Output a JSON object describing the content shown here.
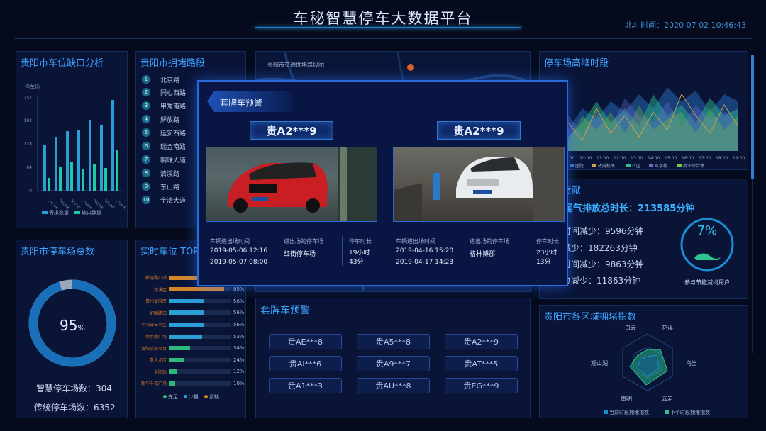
{
  "header": {
    "title": "车秘智慧停车大数据平台",
    "time_label": "北斗时间：",
    "time_value": "2020 07 02 10:46:43"
  },
  "gap_panel": {
    "title": "贵阳市车位缺口分析",
    "y_unit": "停车场",
    "y_ticks": [
      "257",
      "192",
      "128",
      "64",
      "0"
    ],
    "x_labels": [
      "2013年",
      "2014年",
      "2015年",
      "2016年",
      "2017年",
      "2018年",
      "2019年"
    ],
    "legend": [
      "需求数量",
      "缺口数量"
    ],
    "colors": [
      "#2a9fd6",
      "#1ec9a8"
    ]
  },
  "congest_panel": {
    "title": "贵阳市拥堵路段",
    "roads": [
      "北京路",
      "同心西路",
      "甲秀南路",
      "解放路",
      "延安西路",
      "瑞金南路",
      "明珠大道",
      "清溪路",
      "东山路",
      "金清大道"
    ]
  },
  "map_panel": {
    "title": "贵阳市交通拥堵路段图"
  },
  "peak_panel": {
    "title": "停车场高峰时段",
    "x_labels": [
      "09:00",
      "10:00",
      "11:00",
      "12:00",
      "13:00",
      "14:00",
      "15:00",
      "16:00",
      "17:00",
      "18:00",
      "19:00"
    ],
    "legend": [
      "医院",
      "政府机关",
      "社区",
      "写字楼",
      "商业综合体"
    ],
    "colors": [
      "#2a78c8",
      "#c9a24a",
      "#2ec28e",
      "#6a6ad8",
      "#7ac84a"
    ]
  },
  "env_panel": {
    "title": "环保贡献",
    "headline": "减少尾气排放总时长：213585分钟",
    "lines": [
      "寻车时间减少：9596分钟",
      "诱导减少：182263分钟",
      "排队时间减少：9863分钟",
      "找车位减少：11863分钟"
    ],
    "ring_value": "7%",
    "ring_label": "参与节能减排用户"
  },
  "total_panel": {
    "title": "贵阳市停车场总数",
    "donut_value": "95",
    "donut_unit": "%",
    "donut_fraction": 0.95,
    "smart_label": "智慧停车场数：304",
    "traditional_label": "传统停车场数：6352"
  },
  "realtime_panel": {
    "title": "实时车位 TOP",
    "rows": [
      {
        "label": "新瑞路口站",
        "pct": "91%",
        "value": 0.91,
        "color": "#d6862a"
      },
      {
        "label": "花溪区",
        "pct": "89%",
        "value": 0.89,
        "color": "#d6862a"
      },
      {
        "label": "贵州省府医",
        "pct": "56%",
        "value": 0.56,
        "color": "#2a9fd6"
      },
      {
        "label": "护国路口",
        "pct": "56%",
        "value": 0.56,
        "color": "#2a9fd6"
      },
      {
        "label": "小河白云小区",
        "pct": "56%",
        "value": 0.56,
        "color": "#2a9fd6"
      },
      {
        "label": "喷水池广场",
        "pct": "53%",
        "value": 0.53,
        "color": "#2a9fd6"
      },
      {
        "label": "贵阳乐湾项目",
        "pct": "34%",
        "value": 0.34,
        "color": "#2eb87a"
      },
      {
        "label": "贵大北区",
        "pct": "24%",
        "value": 0.24,
        "color": "#2eb87a"
      },
      {
        "label": "金阳站",
        "pct": "12%",
        "value": 0.12,
        "color": "#2eb87a"
      },
      {
        "label": "新华千禧广场",
        "pct": "10%",
        "value": 0.1,
        "color": "#2eb87a"
      }
    ],
    "legend": [
      "充足",
      "少量",
      "紧缺"
    ],
    "legend_colors": [
      "#2eb87a",
      "#2a9fd6",
      "#d6862a"
    ]
  },
  "modal": {
    "tab_label": "套牌车预警",
    "records": [
      {
        "plate": "贵A2***9",
        "col1_head": "车辆进出场时间",
        "col2_head": "进出场的停车场",
        "col3_head": "停车时长",
        "time1": "2019-05-06 12:16",
        "time2": "2019-05-07 08:00",
        "lot": "红街停车场",
        "duration": "19小时43分"
      },
      {
        "plate": "贵A2***9",
        "col1_head": "车辆进出场时间",
        "col2_head": "进出场的停车场",
        "col3_head": "停车时长",
        "time1": "2019-04-16 15:20",
        "time2": "2019-04-17 14:23",
        "lot": "格林博郡",
        "duration": "23小时13分"
      }
    ]
  },
  "fake_panel": {
    "title": "套牌车预警",
    "plates": [
      "贵AE***8",
      "贵A5***8",
      "贵A2***9",
      "贵AI***6",
      "贵A9***7",
      "贵AT***5",
      "贵A1***3",
      "贵AU***8",
      "贵EG***9"
    ]
  },
  "radar_panel": {
    "title": "贵阳市各区域拥堵指数",
    "axes": [
      "白云",
      "花溪",
      "乌当",
      "云岩",
      "南明",
      "观山湖"
    ],
    "legend": [
      "当前时段拥堵指数",
      "下个时段拥堵指数"
    ]
  }
}
